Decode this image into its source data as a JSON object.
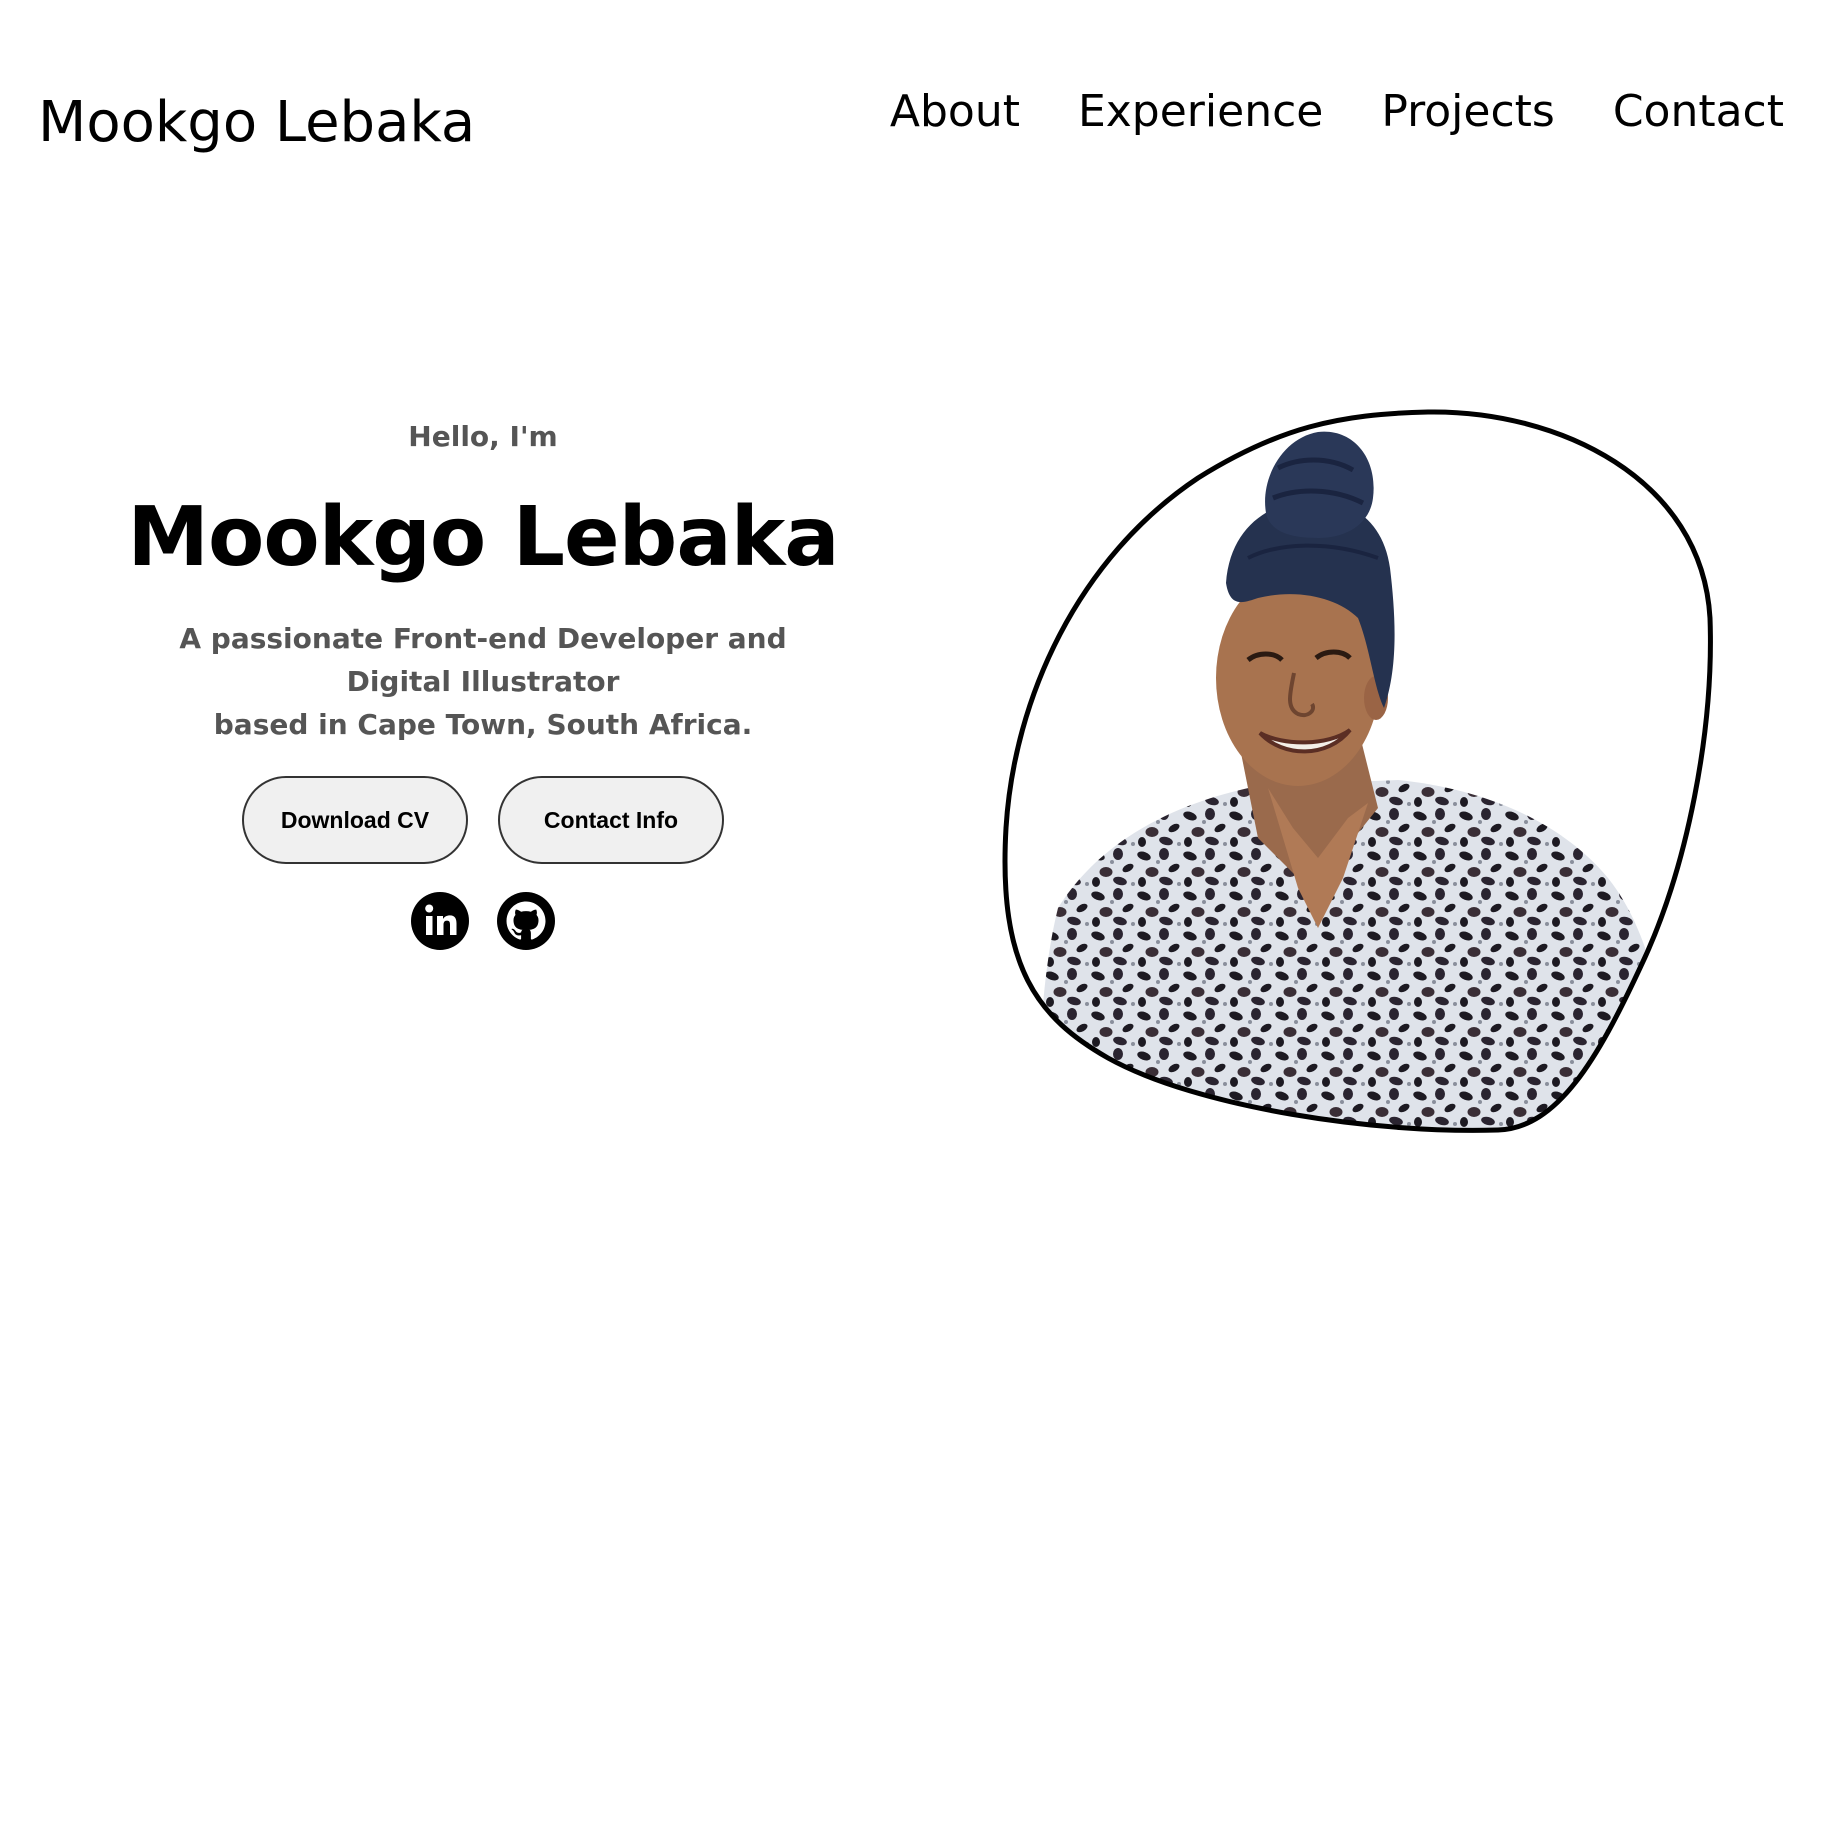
{
  "header": {
    "logo": "Mookgo Lebaka",
    "nav": [
      "About",
      "Experience",
      "Projects",
      "Contact"
    ]
  },
  "hero": {
    "greeting": "Hello, I'm",
    "name": "Mookgo Lebaka",
    "tagline_line1": "A passionate Front-end Developer and Digital Illustrator",
    "tagline_line2": "based in Cape Town, South Africa.",
    "buttons": {
      "download_cv": "Download CV",
      "contact_info": "Contact Info"
    },
    "socials": [
      "linkedin-icon",
      "github-icon"
    ]
  },
  "colors": {
    "text": "#000000",
    "muted": "#555555",
    "button_bg": "#f0f0f0",
    "button_border": "#333333"
  }
}
